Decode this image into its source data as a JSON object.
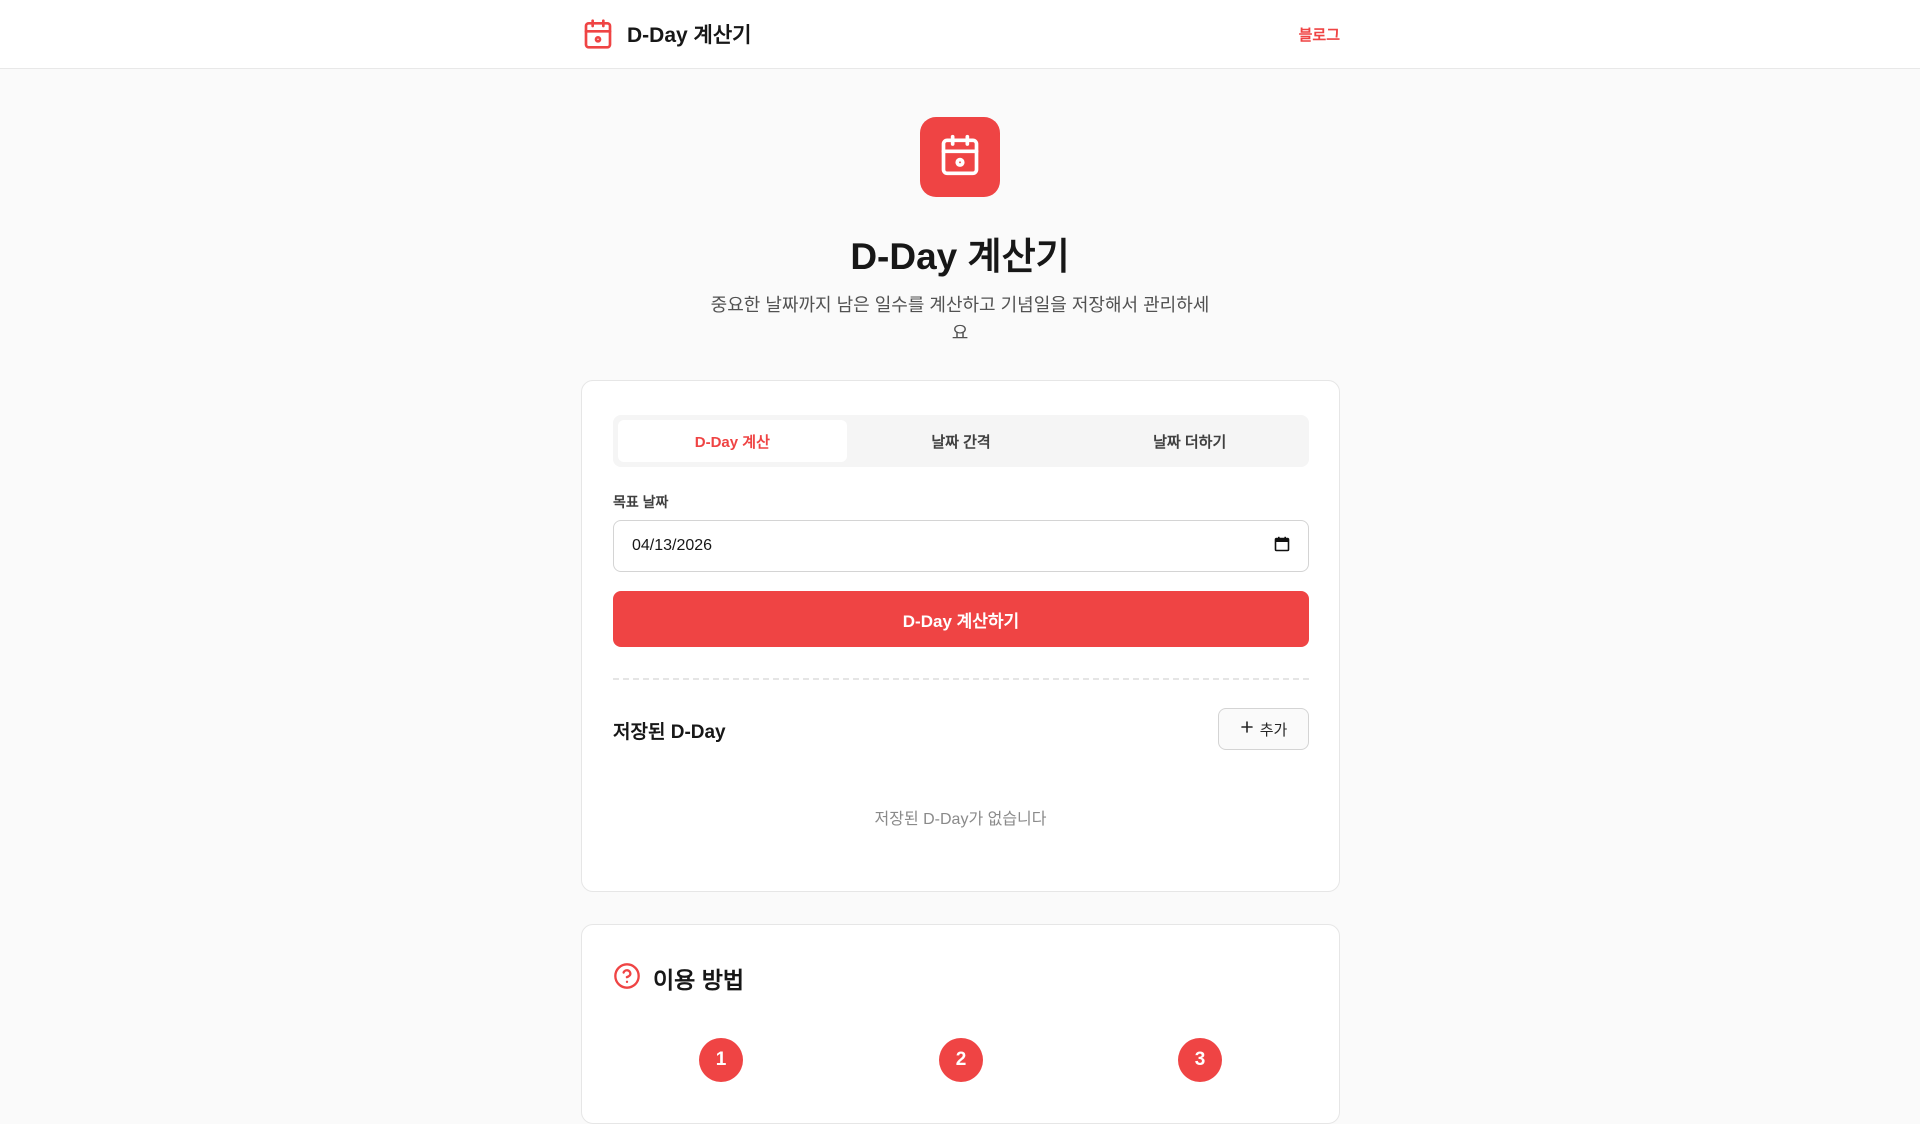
{
  "header": {
    "brand_title": "D-Day 계산기",
    "nav_link": "블로그"
  },
  "hero": {
    "title": "D-Day 계산기",
    "subtitle": "중요한 날짜까지 남은 일수를 계산하고 기념일을 저장해서 관리하세요"
  },
  "tabs": [
    {
      "label": "D-Day 계산",
      "active": true
    },
    {
      "label": "날짜 간격",
      "active": false
    },
    {
      "label": "날짜 더하기",
      "active": false
    }
  ],
  "form": {
    "target_date_label": "목표 날짜",
    "target_date_value": "04/13/2026",
    "submit_label": "D-Day 계산하기"
  },
  "saved": {
    "title": "저장된 D-Day",
    "add_label": "추가",
    "empty_message": "저장된 D-Day가 없습니다"
  },
  "guide": {
    "title": "이용 방법",
    "steps": [
      "1",
      "2",
      "3"
    ]
  },
  "colors": {
    "accent": "#ef4444",
    "background": "#fafafa",
    "card": "#ffffff"
  },
  "icons": {
    "brand": "calendar-icon",
    "hero": "calendar-icon",
    "date_picker": "calendar-icon",
    "add": "plus-icon",
    "guide": "help-circle-icon"
  }
}
